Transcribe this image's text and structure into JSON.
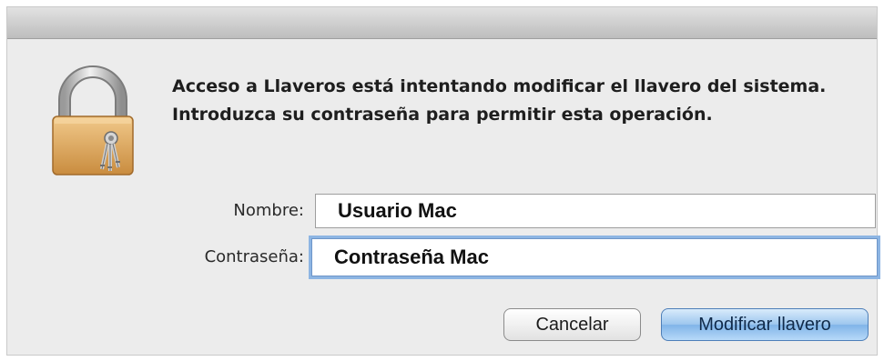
{
  "dialog": {
    "message": "Acceso a Llaveros está intentando modificar el llavero del sistema. Introduzca su contraseña para permitir esta operación.",
    "icon": "padlock-with-keys-icon"
  },
  "form": {
    "name_label": "Nombre:",
    "name_value": "Usuario Mac",
    "password_label": "Contraseña:",
    "password_value": "Contraseña Mac"
  },
  "buttons": {
    "cancel_label": "Cancelar",
    "confirm_label": "Modificar llavero"
  },
  "colors": {
    "dialog_background": "#ececec",
    "focus_ring": "#8db5e3",
    "default_button": "#80b4e8"
  }
}
